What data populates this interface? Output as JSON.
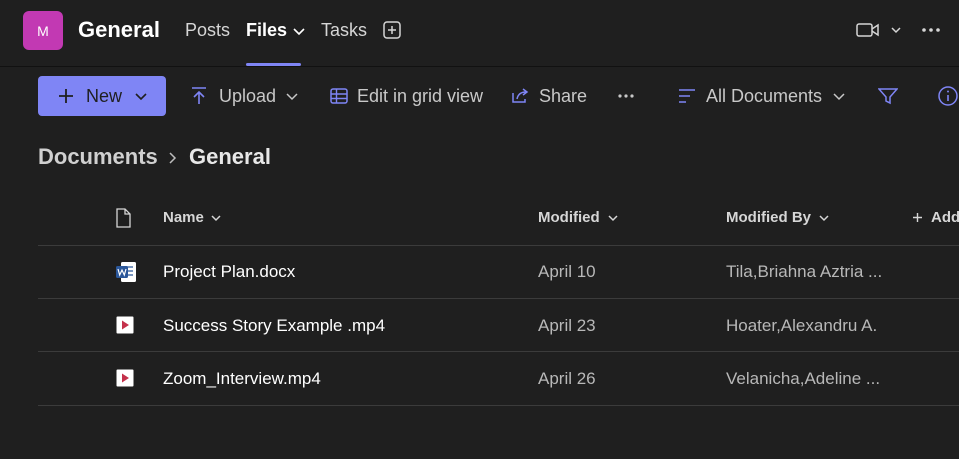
{
  "header": {
    "avatar_letter": "M",
    "avatar_color": "#c239b3",
    "channel_title": "General",
    "tabs": [
      {
        "label": "Posts"
      },
      {
        "label": "Files"
      },
      {
        "label": "Tasks"
      }
    ],
    "add_tab_icon": "plus-square-icon",
    "video_icon": "video-camera-icon",
    "more_icon": "ellipsis-icon"
  },
  "toolbar": {
    "new_label": "New",
    "upload_label": "Upload",
    "grid_label": "Edit in grid view",
    "share_label": "Share",
    "view_label": "All Documents",
    "accent": "#7f85f5"
  },
  "breadcrumb": {
    "root": "Documents",
    "current": "General"
  },
  "table": {
    "columns": {
      "name": "Name",
      "modified": "Modified",
      "modified_by": "Modified By",
      "add_column": "Add"
    },
    "rows": [
      {
        "name": "Project Plan.docx",
        "modified": "April 10",
        "modified_by": "Tila,Briahna Aztria ...",
        "type": "word-doc-icon"
      },
      {
        "name": "Success Story Example .mp4",
        "modified": "April 23",
        "modified_by": "Hoater,Alexandru A.",
        "type": "video-file-icon"
      },
      {
        "name": "Zoom_Interview.mp4",
        "modified": "April 26",
        "modified_by": "Velanicha,Adeline ...",
        "type": "video-file-icon"
      }
    ]
  }
}
